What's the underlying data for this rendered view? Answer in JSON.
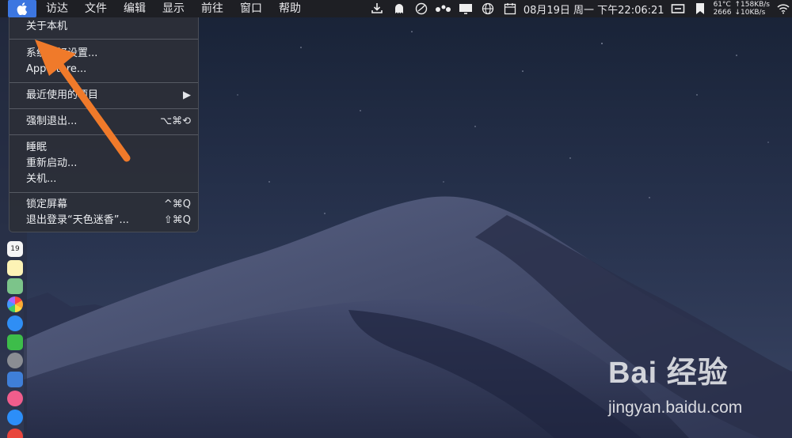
{
  "menubar": {
    "app_menus": [
      "访达",
      "文件",
      "编辑",
      "显示",
      "前往",
      "窗口",
      "帮助"
    ],
    "clock": "08月19日 周一 下午22:06:21",
    "stats": {
      "temp": "61°C",
      "rpm": "2666",
      "up": "↑158KB/s",
      "down": "↓10KB/s"
    },
    "status_icons": [
      "download-icon",
      "ghost-icon",
      "compass-icon",
      "dots-icon",
      "monitor-icon",
      "globe-icon",
      "calendar-icon",
      "display-icon",
      "bookmark-icon",
      "wifi-icon"
    ]
  },
  "apple_menu": {
    "items": [
      {
        "label": "关于本机",
        "shortcut": ""
      },
      {
        "label": "系统偏好设置...",
        "shortcut": ""
      },
      {
        "label": "App Store...",
        "shortcut": ""
      },
      {
        "label": "最近使用的项目",
        "shortcut": "▶"
      },
      {
        "label": "强制退出...",
        "shortcut": "⌥⌘⟲"
      },
      {
        "label": "睡眠",
        "shortcut": ""
      },
      {
        "label": "重新启动...",
        "shortcut": ""
      },
      {
        "label": "关机...",
        "shortcut": ""
      },
      {
        "label": "锁定屏幕",
        "shortcut": "^⌘Q"
      },
      {
        "label": "退出登录“天色迷香”...",
        "shortcut": "⇧⌘Q"
      }
    ]
  },
  "dock": {
    "calendar_day": "19"
  },
  "watermark": {
    "logo": "Bai 经验",
    "url": "jingyan.baidu.com"
  },
  "colors": {
    "menubar_bg": "#1e1f24",
    "apple_highlight": "#3c76e0",
    "menu_bg": "#2c2f38",
    "arrow": "#f07a2a"
  }
}
